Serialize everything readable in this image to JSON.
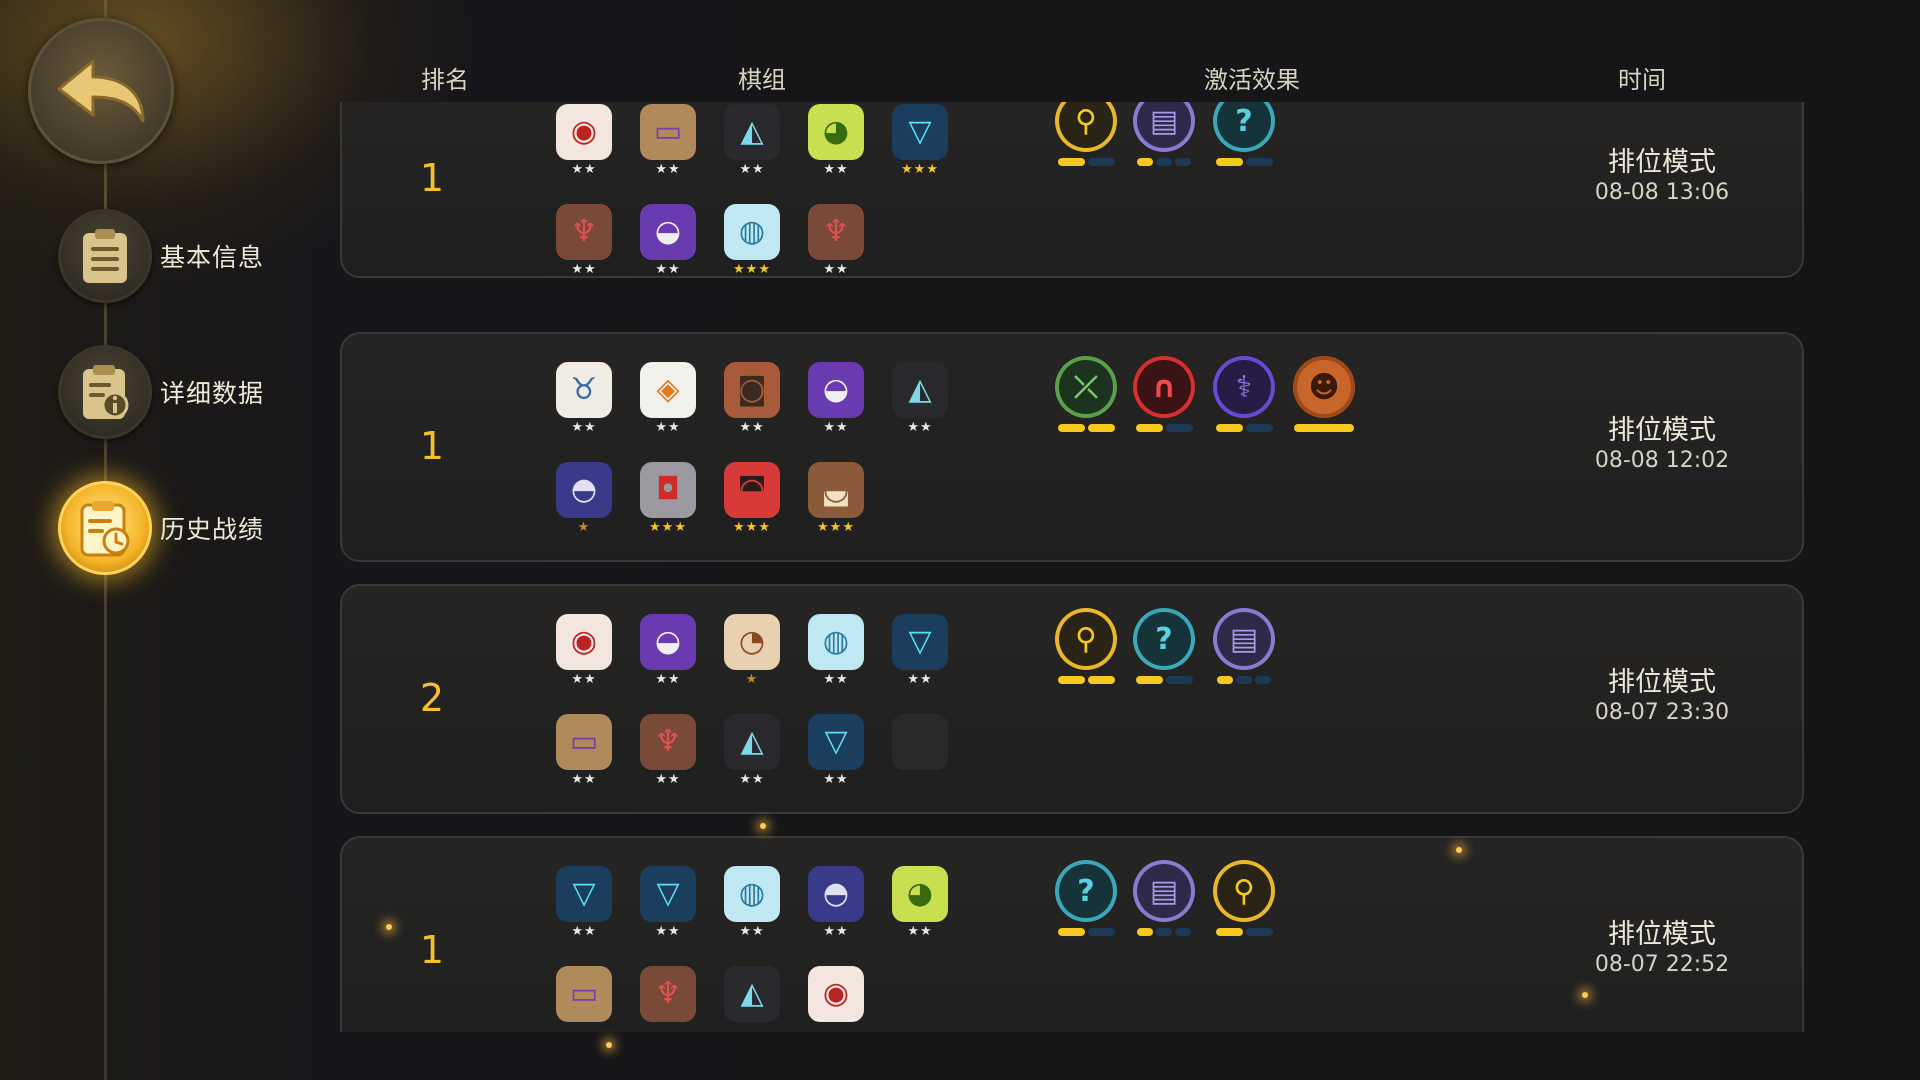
{
  "colors": {
    "accent_gold": "#f3c12c",
    "bar_on": "#f6c91e",
    "bar_off": "#1c3a55"
  },
  "sidebar": {
    "back_icon": "back-arrow-icon",
    "items": [
      {
        "label": "基本信息",
        "icon": "clipboard-icon",
        "active": false
      },
      {
        "label": "详细数据",
        "icon": "info-document-icon",
        "active": false
      },
      {
        "label": "历史战绩",
        "icon": "history-clock-icon",
        "active": true
      }
    ]
  },
  "table": {
    "headers": {
      "rank": "排名",
      "pieces": "棋组",
      "synergies": "激活效果",
      "time": "时间"
    },
    "rows": [
      {
        "rank": "1",
        "mode": "排位模式",
        "time": "08-08 13:06",
        "pieces": [
          {
            "icon": "red-brute-icon",
            "stars": 2
          },
          {
            "icon": "bandaged-mummy-icon",
            "stars": 2
          },
          {
            "icon": "dark-knight-icon",
            "stars": 2
          },
          {
            "icon": "green-goblin-icon",
            "stars": 2
          },
          {
            "icon": "blue-crystal-icon",
            "stars": 3
          },
          {
            "icon": "horned-warrior-icon",
            "stars": 2
          },
          {
            "icon": "purple-witch-icon",
            "stars": 2
          },
          {
            "icon": "ice-beast-icon",
            "stars": 3
          },
          {
            "icon": "horned-warrior-icon",
            "stars": 2
          }
        ],
        "synergies": [
          {
            "icon": "gold-emblem-icon",
            "on": 1,
            "total": 2
          },
          {
            "icon": "purple-tome-icon",
            "on": 1,
            "total": 3
          },
          {
            "icon": "teal-rune-icon",
            "on": 1,
            "total": 2
          }
        ]
      },
      {
        "rank": "1",
        "mode": "排位模式",
        "time": "08-08 12:02",
        "pieces": [
          {
            "icon": "white-horned-icon",
            "stars": 2
          },
          {
            "icon": "orange-knight-icon",
            "stars": 2
          },
          {
            "icon": "masked-bandit-icon",
            "stars": 2
          },
          {
            "icon": "purple-witch-icon",
            "stars": 2
          },
          {
            "icon": "dark-knight-icon",
            "stars": 2
          },
          {
            "icon": "blue-hood-icon",
            "stars": 1
          },
          {
            "icon": "red-golem-icon",
            "stars": 3
          },
          {
            "icon": "red-demon-icon",
            "stars": 3
          },
          {
            "icon": "bearded-dwarf-icon",
            "stars": 3
          }
        ],
        "synergies": [
          {
            "icon": "green-bow-icon",
            "on": 2,
            "total": 2
          },
          {
            "icon": "red-arch-icon",
            "on": 1,
            "total": 2
          },
          {
            "icon": "purple-fish-icon",
            "on": 1,
            "total": 2
          },
          {
            "icon": "orange-beast-icon",
            "on": 1,
            "total": 1
          }
        ]
      },
      {
        "rank": "2",
        "mode": "排位模式",
        "time": "08-07 23:30",
        "pieces": [
          {
            "icon": "red-brute-icon",
            "stars": 2
          },
          {
            "icon": "purple-witch-icon",
            "stars": 2
          },
          {
            "icon": "bearded-sage-icon",
            "stars": 1
          },
          {
            "icon": "ice-beast-icon",
            "stars": 2
          },
          {
            "icon": "blue-crystal-icon",
            "stars": 2
          },
          {
            "icon": "bandaged-mummy-icon",
            "stars": 2
          },
          {
            "icon": "horned-warrior-icon",
            "stars": 2
          },
          {
            "icon": "dark-knight-icon",
            "stars": 2
          },
          {
            "icon": "blue-crystal-icon",
            "stars": 2
          },
          {
            "icon": "empty-slot",
            "stars": 0
          }
        ],
        "synergies": [
          {
            "icon": "gold-emblem-icon",
            "on": 2,
            "total": 2
          },
          {
            "icon": "teal-rune-icon",
            "on": 1,
            "total": 2
          },
          {
            "icon": "purple-tome-icon",
            "on": 1,
            "total": 3
          }
        ]
      },
      {
        "rank": "1",
        "mode": "排位模式",
        "time": "08-07 22:52",
        "pieces": [
          {
            "icon": "blue-crystal-icon",
            "stars": 2
          },
          {
            "icon": "blue-crystal-icon",
            "stars": 2
          },
          {
            "icon": "ice-beast-icon",
            "stars": 2
          },
          {
            "icon": "blue-hood-icon",
            "stars": 2
          },
          {
            "icon": "green-goblin-icon",
            "stars": 2
          },
          {
            "icon": "bandaged-mummy-icon",
            "stars": 0
          },
          {
            "icon": "horned-warrior-icon",
            "stars": 0
          },
          {
            "icon": "dark-knight-icon",
            "stars": 0
          },
          {
            "icon": "red-brute-icon",
            "stars": 0
          }
        ],
        "synergies": [
          {
            "icon": "teal-rune-icon",
            "on": 1,
            "total": 2
          },
          {
            "icon": "purple-tome-icon",
            "on": 1,
            "total": 3
          },
          {
            "icon": "gold-emblem-icon",
            "on": 1,
            "total": 2
          }
        ]
      }
    ]
  }
}
